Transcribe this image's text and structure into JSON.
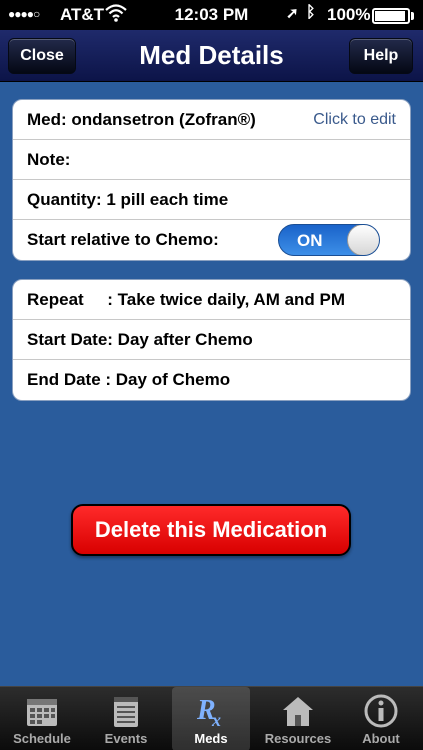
{
  "status_bar": {
    "signal": "●●●●○",
    "carrier": "AT&T",
    "time": "12:03 PM",
    "battery": "100%"
  },
  "nav": {
    "close_label": "Close",
    "title": "Med Details",
    "help_label": "Help"
  },
  "details": {
    "med_label": "Med: ondansetron (Zofran®)",
    "edit_label": "Click to edit",
    "note_label": "Note:",
    "note_value": "",
    "quantity_label": "Quantity: 1 pill each time",
    "relative_label": "Start relative to Chemo:",
    "toggle_label": "ON",
    "toggle_on": true
  },
  "schedule": {
    "repeat_label": "Repeat     : Take twice daily, AM and PM",
    "start_label": "Start Date: Day after Chemo",
    "end_label": "End Date : Day of Chemo"
  },
  "delete_label": "Delete this Medication",
  "tabs": [
    {
      "label": "Schedule",
      "icon": "calendar-icon",
      "active": false
    },
    {
      "label": "Events",
      "icon": "notepad-icon",
      "active": false
    },
    {
      "label": "Meds",
      "icon": "rx-icon",
      "active": true
    },
    {
      "label": "Resources",
      "icon": "house-icon",
      "active": false
    },
    {
      "label": "About",
      "icon": "info-icon",
      "active": false
    }
  ],
  "colors": {
    "background": "#2a5c9c",
    "nav": "#0c1448",
    "delete": "#e00000",
    "toggle": "#2f7fe0",
    "link": "#3a5a8c"
  }
}
